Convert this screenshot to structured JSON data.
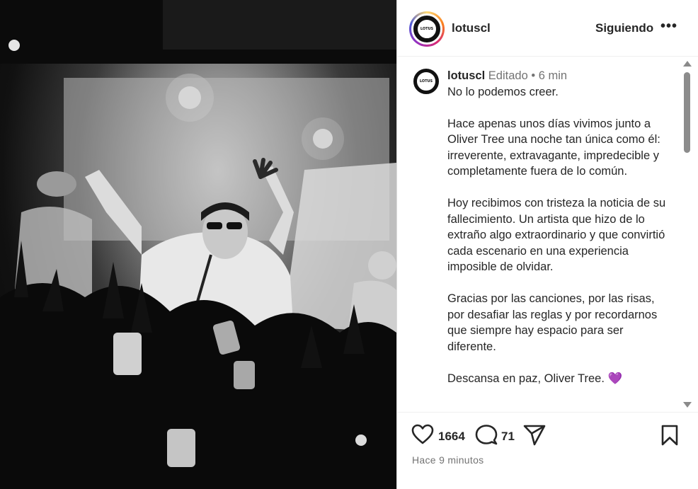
{
  "photo": {
    "alt_icon": "concert-photo"
  },
  "header": {
    "logo_text": "LOTUS",
    "username": "lotuscl",
    "follow_state": "Siguiendo",
    "more": "•••"
  },
  "caption": {
    "username": "lotuscl",
    "edited": "Editado",
    "separator": "•",
    "age": "6 min",
    "logo_text": "LOTUS",
    "p1": "No lo podemos creer.",
    "p2": "Hace apenas unos días vivimos junto a Oliver Tree una noche tan única como él: irreverente, extravagante, impredecible y completamente fuera de lo común.",
    "p3": "Hoy recibimos con tristeza la noticia de su fallecimiento. Un artista que hizo de lo extraño algo extraordinario y que convirtió cada escenario en una experiencia imposible de olvidar.",
    "p4": "Gracias por las canciones, por las risas, por desafiar las reglas y por recordarnos que siempre hay espacio para ser diferente.",
    "p5": "Descansa en paz, Oliver Tree.",
    "emoji": "💜"
  },
  "actions": {
    "likes": "1664",
    "comments": "71",
    "timestamp": "Hace 9 minutos"
  }
}
